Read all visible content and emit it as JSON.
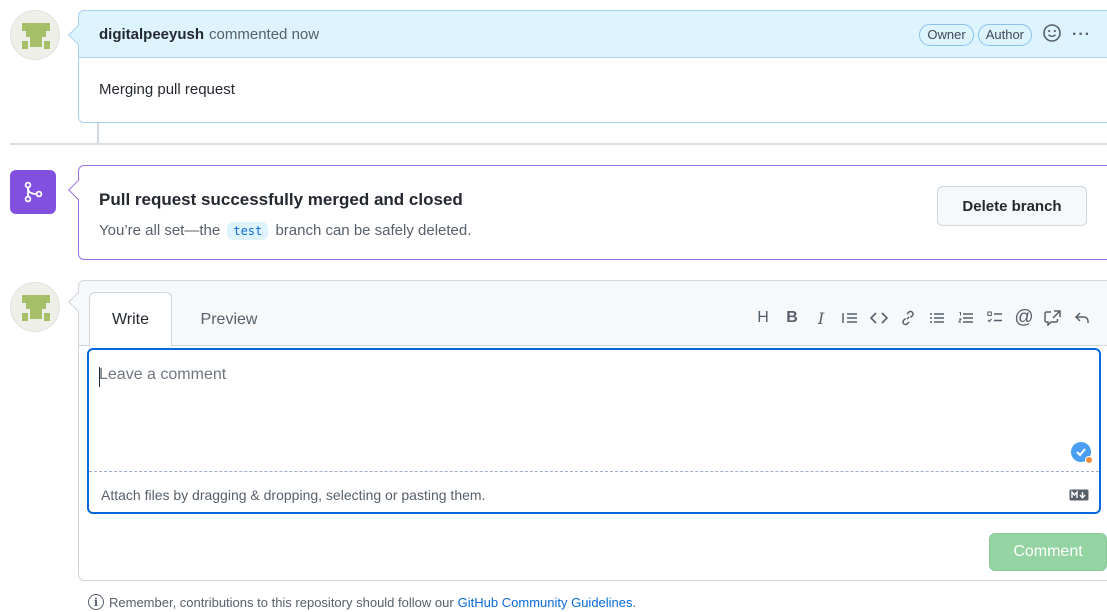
{
  "comment": {
    "author": "digitalpeeyush",
    "action": "commented now",
    "badges": [
      "Owner",
      "Author"
    ],
    "emoji_icon": "smiley-icon",
    "more_icon": "kebab-horizontal-icon",
    "more_glyph": "···",
    "body": "Merging pull request"
  },
  "merge": {
    "icon": "git-merge-icon",
    "title": "Pull request successfully merged and closed",
    "subtitle_prefix": "You’re all set—the",
    "branch": "test",
    "subtitle_suffix": "branch can be safely deleted.",
    "delete_button": "Delete branch"
  },
  "new_comment": {
    "tabs": [
      "Write",
      "Preview"
    ],
    "toolbar": [
      {
        "icon": "heading-icon",
        "glyph": "H"
      },
      {
        "icon": "bold-icon",
        "glyph": "B"
      },
      {
        "icon": "italic-icon",
        "glyph": "I"
      },
      {
        "icon": "quote-icon",
        "glyph": "⁝≡"
      },
      {
        "icon": "code-icon",
        "glyph": "<>"
      },
      {
        "icon": "link-icon",
        "glyph": "🔗"
      },
      {
        "icon": "unordered-list-icon",
        "glyph": "☰"
      },
      {
        "icon": "ordered-list-icon",
        "glyph": "≡"
      },
      {
        "icon": "task-list-icon",
        "glyph": "☑"
      },
      {
        "icon": "mention-icon",
        "glyph": "@"
      },
      {
        "icon": "cross-reference-icon",
        "glyph": "⇱"
      },
      {
        "icon": "reply-icon",
        "glyph": "↶"
      }
    ],
    "placeholder": "Leave a comment",
    "attach_text": "Attach files by dragging & dropping, selecting or pasting them.",
    "markdown_icon": "markdown-icon",
    "submit_label": "Comment"
  },
  "footer": {
    "text": "Remember, contributions to this repository should follow our",
    "link": "GitHub Community Guidelines",
    "end": "."
  },
  "colors": {
    "header_bg": "#ddf4ff",
    "merge_purple": "#8250df",
    "focus_blue": "#0969da",
    "submit_disabled": "#94d3a2"
  }
}
